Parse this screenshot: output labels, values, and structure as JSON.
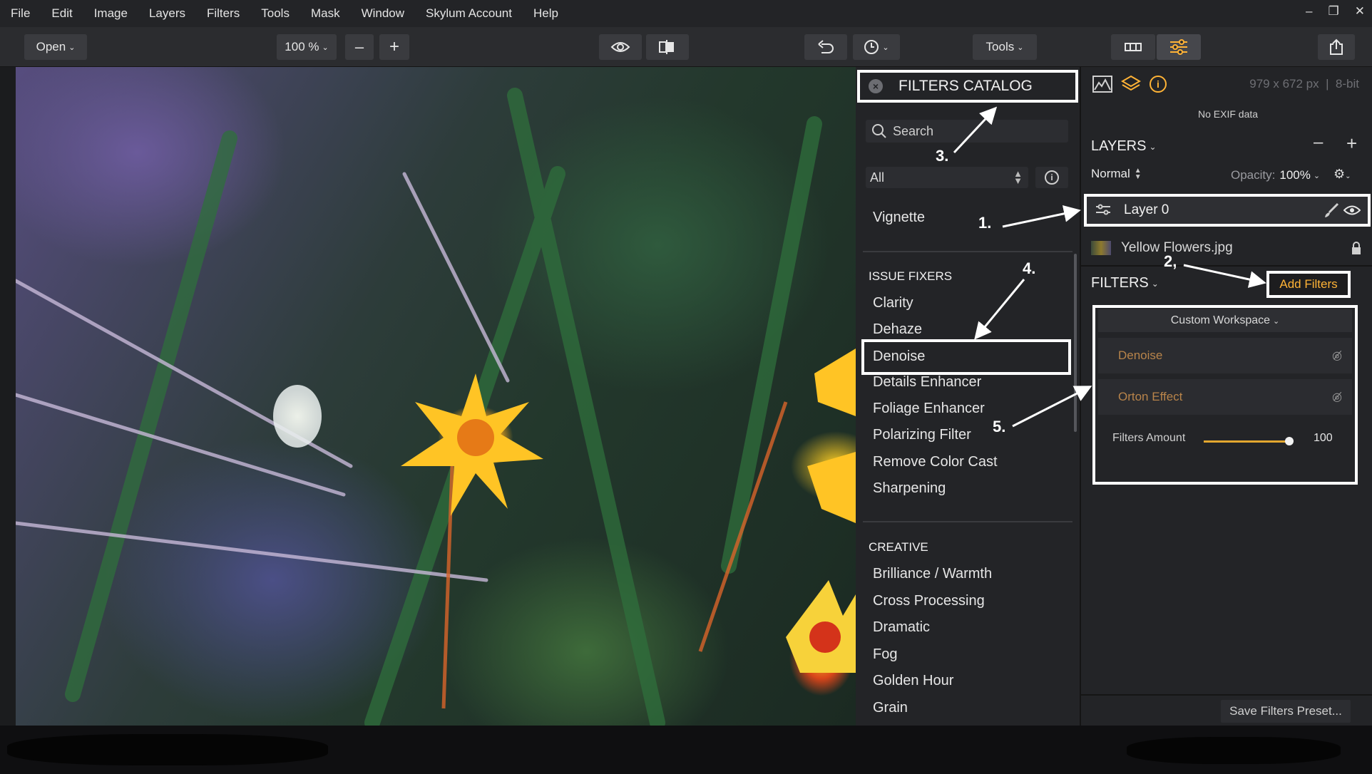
{
  "menu": [
    "File",
    "Edit",
    "Image",
    "Layers",
    "Filters",
    "Tools",
    "Mask",
    "Window",
    "Skylum Account",
    "Help"
  ],
  "window_controls": {
    "minimize": "–",
    "restore": "❐",
    "close": "✕"
  },
  "toolbar": {
    "open_label": "Open",
    "zoom_value": "100 %",
    "zoom_out_label": "–",
    "zoom_in_label": "+",
    "tools_label": "Tools"
  },
  "catalog": {
    "title": "FILTERS CATALOG",
    "close_glyph": "×",
    "search_placeholder": "Search",
    "category_value": "All",
    "top_items": [
      "Vignette"
    ],
    "sections": [
      {
        "title": "ISSUE FIXERS",
        "items": [
          "Clarity",
          "Dehaze",
          "Denoise",
          "Details Enhancer",
          "Foliage Enhancer",
          "Polarizing Filter",
          "Remove Color Cast",
          "Sharpening"
        ]
      },
      {
        "title": "CREATIVE",
        "items": [
          "Brilliance / Warmth",
          "Cross Processing",
          "Dramatic",
          "Fog",
          "Golden Hour",
          "Grain"
        ]
      }
    ]
  },
  "right_panel": {
    "image_info": "979 x 672 px  |  8-bit",
    "exif": "No EXIF data",
    "layers_title": "LAYERS",
    "blend_mode": "Normal",
    "opacity_label": "Opacity:",
    "opacity_value": "100%",
    "layers": [
      {
        "name": "Layer 0",
        "selected": true
      },
      {
        "name": "Yellow Flowers.jpg",
        "selected": false,
        "locked": true
      }
    ],
    "filters_title": "FILTERS",
    "add_filters_label": "Add Filters",
    "workspace_label": "Custom Workspace",
    "applied_filters": [
      "Denoise",
      "Orton Effect"
    ],
    "filters_amount_label": "Filters Amount",
    "filters_amount_value": "100",
    "filters_amount_fraction": 1.0,
    "save_preset_label": "Save Filters Preset..."
  },
  "annotations": [
    "1.",
    "2,",
    "3.",
    "4.",
    "5."
  ],
  "colors": {
    "accent": "#ffb336",
    "panel": "#232427",
    "highlight_box": "#ffffff"
  }
}
